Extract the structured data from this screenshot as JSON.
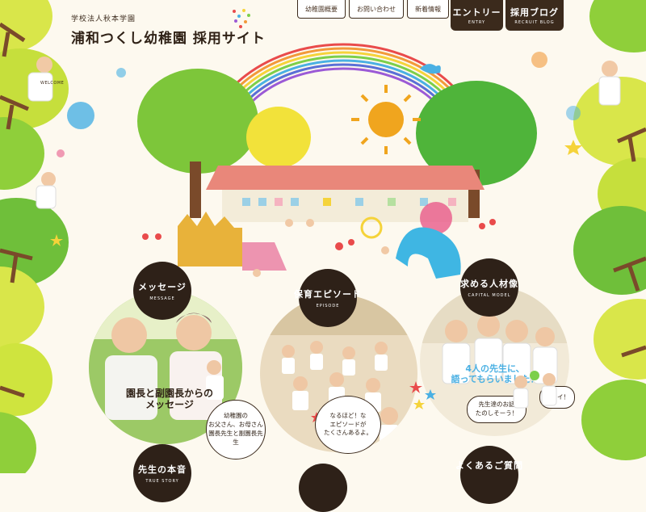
{
  "header": {
    "org_name": "学校法人秋本学園",
    "site_title": "浦和つくし幼稚園 採用サイト"
  },
  "nav": {
    "items": [
      "幼稚園概要",
      "お問い合わせ",
      "新着情報"
    ],
    "entry": {
      "jp": "エントリー",
      "en": "ENTRY"
    },
    "blog": {
      "jp": "採用ブログ",
      "en": "RECRUIT BLOG"
    }
  },
  "sections": {
    "message": {
      "jp": "メッセージ",
      "en": "MESSAGE",
      "overlay": "園長と副園長からの\nメッセージ",
      "bubble": "幼稚園の\nお父さん、お母さん\n園長先生と副園長先生"
    },
    "episode": {
      "jp": "保育エピソード",
      "en": "EPISODE",
      "bubble": "なるほど！な\nエピソードが\nたくさんあるよ。"
    },
    "capital": {
      "jp": "求める人材像",
      "en": "CAPITAL MODEL",
      "overlay": "4人の先生に、\n語ってもらいました！",
      "bubble1": "先生達のお話\nたのしそーう！",
      "bubble2": "イエイ！"
    },
    "truestory": {
      "jp": "先生の本音",
      "en": "TRUE STORY"
    },
    "faq": {
      "jp": "よくあるご質問"
    }
  },
  "illustration": {
    "sign": "WELCOME"
  },
  "colors": {
    "brown": "#3b2a1c",
    "tree_green": "#8fcf3a",
    "tree_yellow": "#d6e24a",
    "rainbow": [
      "#e94b4b",
      "#f29a3a",
      "#f5d33a",
      "#7ccf4a",
      "#4ab0e3",
      "#5a6fd6",
      "#9b5ad6"
    ]
  }
}
